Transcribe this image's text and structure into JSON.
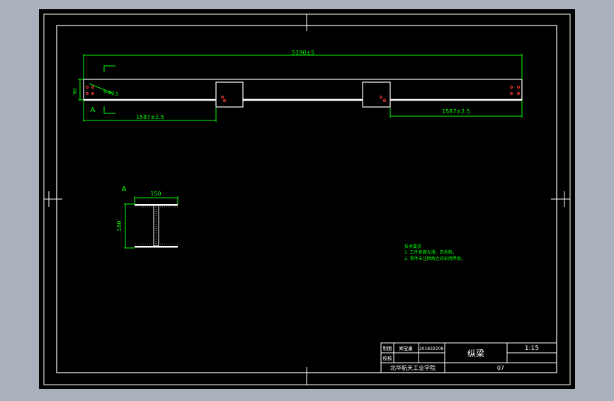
{
  "colors": {
    "viewport_bg": "#a9b1bd",
    "sheet_bg": "#000000",
    "frame": "#ffffff",
    "dimension": "#00ff00",
    "hole": "#ff3b3b",
    "note": "#00ff00"
  },
  "drawing": {
    "overall_length_dim": "5190±5",
    "left_segment_dim": "1587±2.5",
    "right_segment_dim": "1587±2.5",
    "height_dim": "90",
    "hole_callout": "4-Φ13",
    "section_marker": "A"
  },
  "section_view": {
    "label": "A",
    "width_dim": "150",
    "height_dim": "180"
  },
  "notes": {
    "heading": "技术要求",
    "lines": [
      "1. 工件表面光滑，去毛刺。",
      "2. 零件未注倒角之间采用焊接。"
    ]
  },
  "title_block": {
    "role_drawn": "制图",
    "role_checked": "校核",
    "drawer_name": "郑宝康",
    "student_id": "201832208",
    "part_name": "纵梁",
    "scale": "1:15",
    "school": "北华航天工业学院",
    "drawing_number": "07"
  }
}
